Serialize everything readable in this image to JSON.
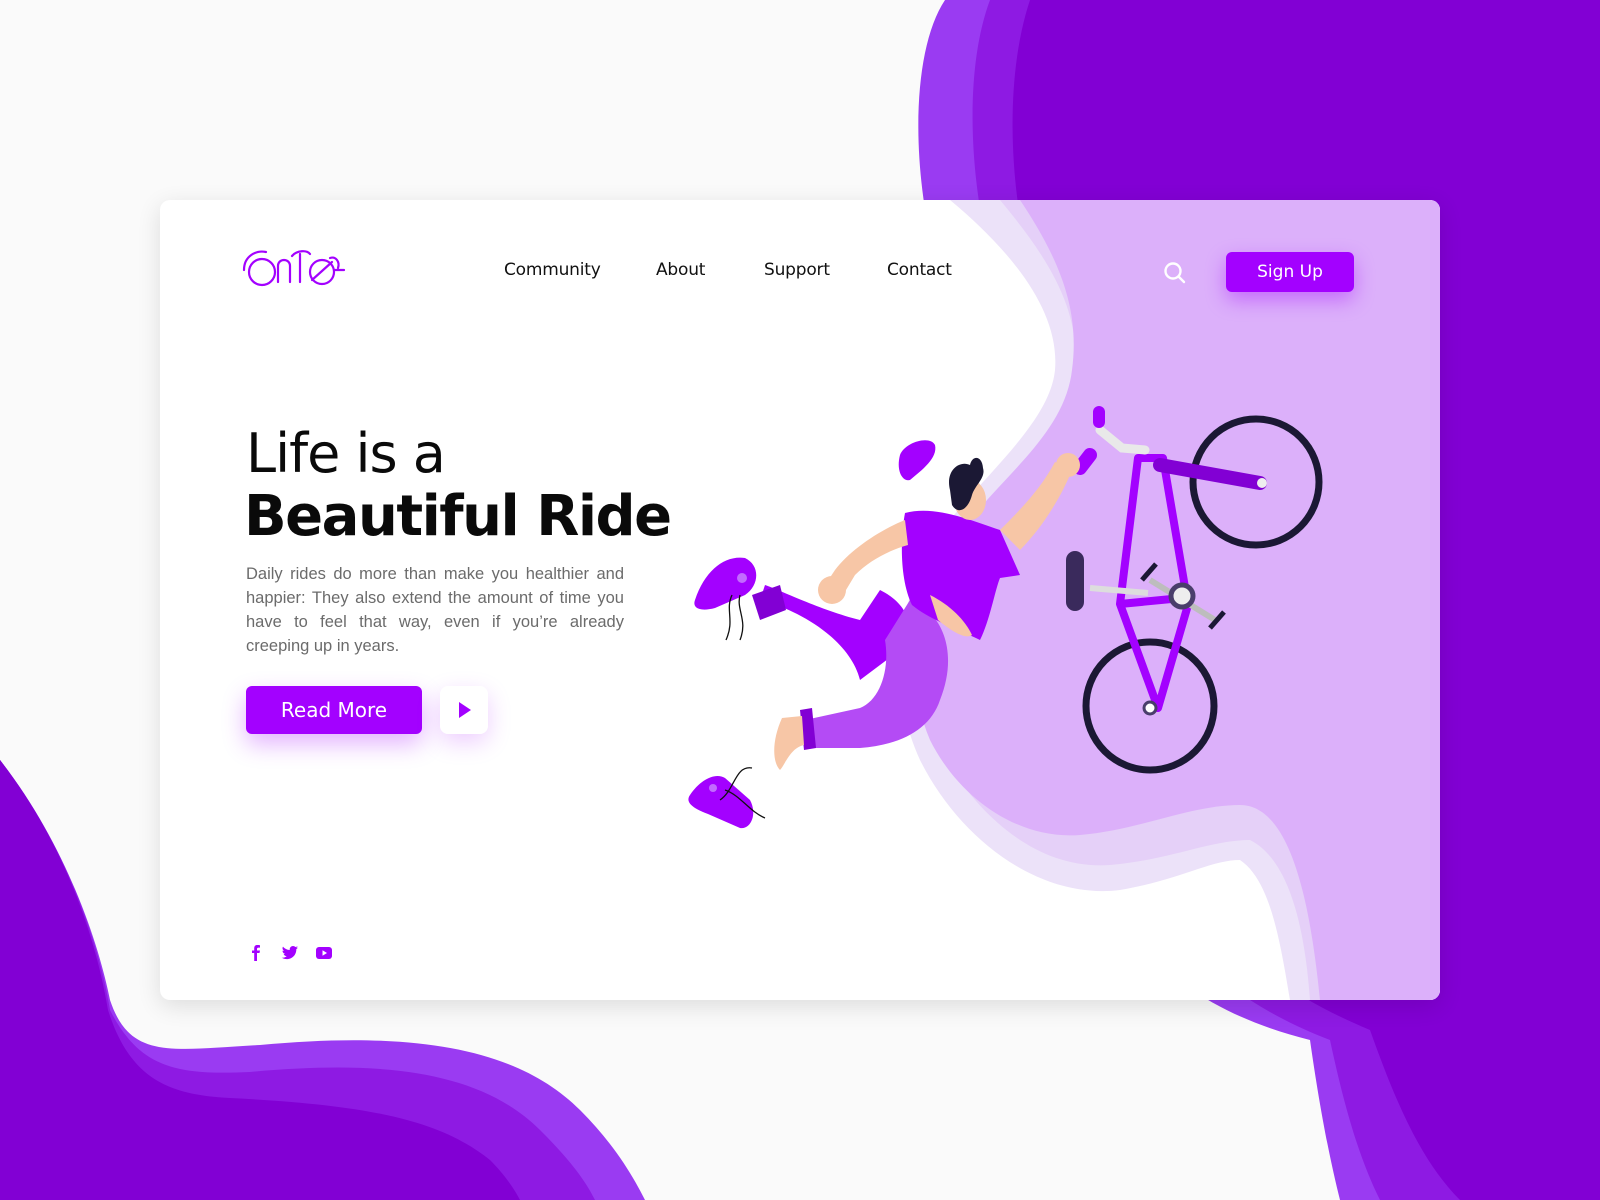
{
  "brand": {
    "logo_text": "ONTE",
    "colors": {
      "primary": "#a301ff",
      "deep_purple": "#8200d4",
      "mid_purple": "#8e1ae3",
      "light_purple": "#9a3bf2",
      "lavender": "#dcb0fa",
      "text_dark": "#0a0a0a",
      "text_muted": "#6b6b6b"
    }
  },
  "nav": {
    "items": [
      {
        "label": "Community"
      },
      {
        "label": "About"
      },
      {
        "label": "Support"
      },
      {
        "label": "Contact"
      }
    ],
    "search_icon": "search-icon",
    "signup_label": "Sign Up"
  },
  "hero": {
    "title_line1": "Life is a",
    "title_line2": "Beautiful Ride",
    "description": "Daily rides do more than make you healthier and happier: They also extend the amount of time you have to feel that way, even if you’re already creeping up in years.",
    "read_more_label": "Read More",
    "play_icon": "play-icon"
  },
  "social": {
    "items": [
      {
        "name": "facebook",
        "icon": "facebook-icon"
      },
      {
        "name": "twitter",
        "icon": "twitter-icon"
      },
      {
        "name": "youtube",
        "icon": "youtube-icon"
      }
    ]
  },
  "illustration": {
    "subject": "man falling off purple bicycle"
  }
}
